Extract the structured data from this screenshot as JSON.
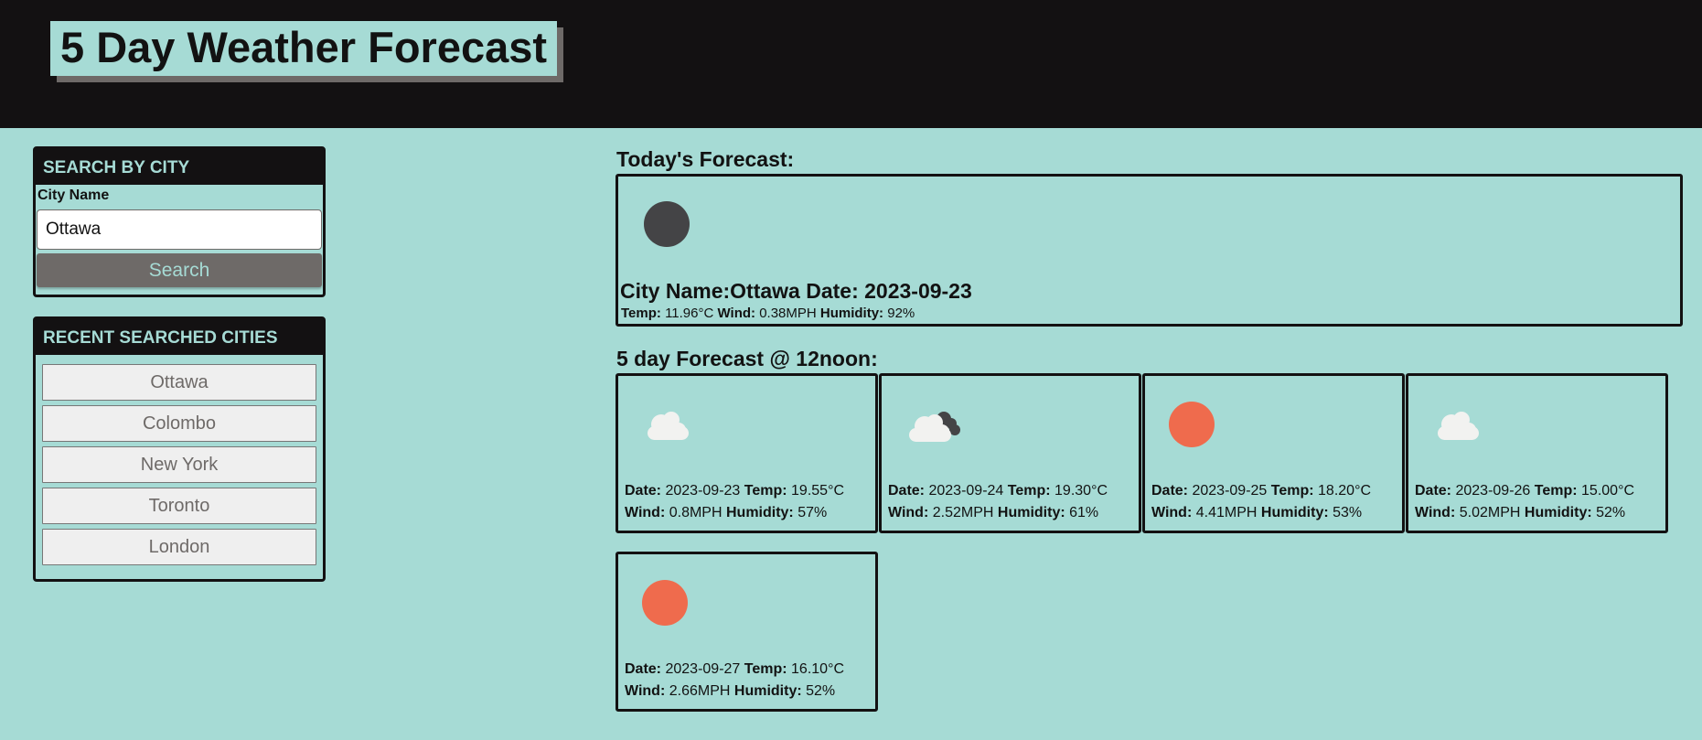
{
  "header": {
    "title": "5 Day Weather Forecast"
  },
  "search": {
    "heading": "SEARCH BY CITY",
    "label": "City Name",
    "value": "Ottawa",
    "button": "Search"
  },
  "recent": {
    "heading": "RECENT SEARCHED CITIES",
    "cities": [
      "Ottawa",
      "Colombo",
      "New York",
      "Toronto",
      "London"
    ]
  },
  "today": {
    "heading": "Today's Forecast:",
    "title": "City Name:Ottawa Date: 2023-09-23",
    "icon": "dark-sun-icon",
    "temp_label": "Temp:",
    "temp": "11.96°C",
    "wind_label": "Wind:",
    "wind": "0.38MPH",
    "humidity_label": "Humidity:",
    "humidity": "92%"
  },
  "forecast": {
    "heading": "5 day Forecast @ 12noon:",
    "labels": {
      "date": "Date:",
      "temp": "Temp:",
      "wind": "Wind:",
      "humidity": "Humidity:"
    },
    "days": [
      {
        "date": "2023-09-23",
        "temp": "19.55°C",
        "wind": "0.8MPH",
        "humidity": "57%",
        "icon": "cloud-icon"
      },
      {
        "date": "2023-09-24",
        "temp": "19.30°C",
        "wind": "2.52MPH",
        "humidity": "61%",
        "icon": "broken-clouds-icon"
      },
      {
        "date": "2023-09-25",
        "temp": "18.20°C",
        "wind": "4.41MPH",
        "humidity": "53%",
        "icon": "sun-icon"
      },
      {
        "date": "2023-09-26",
        "temp": "15.00°C",
        "wind": "5.02MPH",
        "humidity": "52%",
        "icon": "cloud-icon"
      },
      {
        "date": "2023-09-27",
        "temp": "16.10°C",
        "wind": "2.66MPH",
        "humidity": "52%",
        "icon": "sun-icon"
      }
    ]
  },
  "colors": {
    "background": "#a6dbd5",
    "header": "#131112",
    "button": "#6e6a68",
    "sun": "#ef6b4d",
    "cloud": "#f2f2f0",
    "dark": "#444446"
  }
}
